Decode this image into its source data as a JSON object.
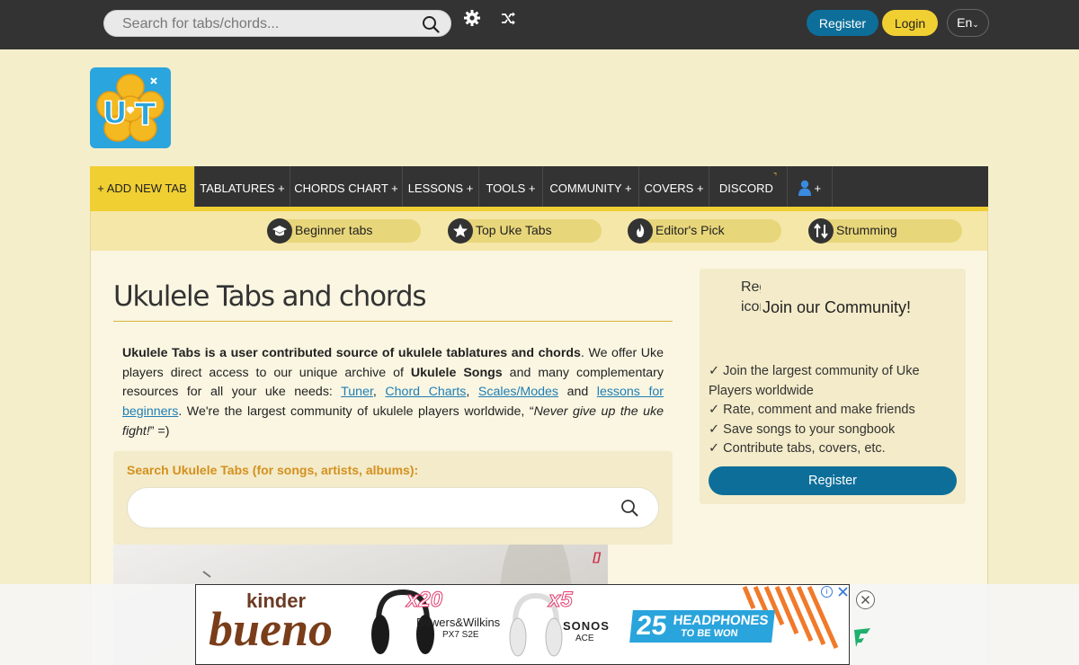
{
  "topbar": {
    "search_placeholder": "Search for tabs/chords...",
    "register_label": "Register",
    "login_label": "Login",
    "language": "En"
  },
  "nav": {
    "items": [
      "+ ADD NEW TAB",
      "TABLATURES +",
      "CHORDS CHART +",
      "LESSONS +",
      "TOOLS +",
      "COMMUNITY +",
      "COVERS +",
      "DISCORD",
      "+"
    ]
  },
  "subnav": {
    "pills": [
      "Beginner tabs",
      "Top Uke Tabs",
      "Editor's Pick",
      "Strumming"
    ]
  },
  "main": {
    "title": "Ukulele Tabs and chords",
    "intro": {
      "bold1": "Ukulele Tabs is a user contributed source of ukulele tablatures and chords",
      "t1": ". We offer Uke players direct access to our unique archive of ",
      "bold2": "Ukulele Songs",
      "t2": " and many complementary resources for all your uke needs: ",
      "link_tuner": "Tuner",
      "sep1": ", ",
      "link_chords": "Chord Charts",
      "sep2": ", ",
      "link_scales": "Scales/Modes",
      "and": " and ",
      "link_lessons": "lessons for beginners",
      "t3": ". We're the largest community of ukulele players worldwide, “",
      "italic": "Never give up the uke fight!",
      "t4": "” =)"
    },
    "search_label": "Search Ukulele Tabs (for songs, artists, albums):",
    "search_value": "",
    "video_flag": "[]"
  },
  "community": {
    "broken_image_alt": "Register icon",
    "title": "Join our Community!",
    "perks": [
      "✓ Join the largest community of Uke Players worldwide",
      "✓ Rate, comment and make friends",
      "✓ Save songs to your songbook",
      "✓ Contribute tabs, covers, etc."
    ],
    "register_label": "Register"
  },
  "ad": {
    "kinder": "kinder",
    "bueno": "bueno",
    "x20": "x20",
    "brand1": "Bowers&Wilkins",
    "model1": "PX7 S2E",
    "x5": "x5",
    "brand2": "SONOS",
    "model2": "ACE",
    "banner_num": "25",
    "banner_t1": "HEADPHONES",
    "banner_t2": "TO BE WON"
  },
  "colors": {
    "topbar": "#333333",
    "accent_yellow": "#f0cf33",
    "accent_blue": "#0d6e99",
    "page_bg": "#f5eecb"
  }
}
